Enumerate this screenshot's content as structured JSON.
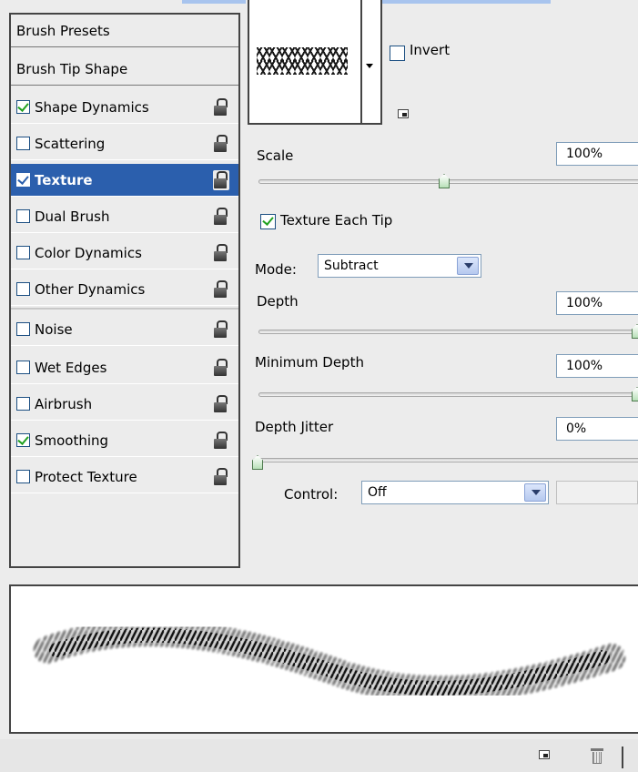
{
  "brush_settings": {
    "list": [
      {
        "label": "Brush Presets",
        "type": "header"
      },
      {
        "label": "Brush Tip Shape",
        "type": "header"
      },
      {
        "label": "Shape Dynamics",
        "checked": true
      },
      {
        "label": "Scattering",
        "checked": false
      },
      {
        "label": "Texture",
        "checked": true,
        "selected": true
      },
      {
        "label": "Dual Brush",
        "checked": false
      },
      {
        "label": "Color Dynamics",
        "checked": false
      },
      {
        "label": "Other Dynamics",
        "checked": false
      },
      {
        "label": "Noise",
        "checked": false
      },
      {
        "label": "Wet Edges",
        "checked": false
      },
      {
        "label": "Airbrush",
        "checked": false
      },
      {
        "label": "Smoothing",
        "checked": true
      },
      {
        "label": "Protect Texture",
        "checked": false
      }
    ]
  },
  "texture": {
    "invert_label": "Invert",
    "invert_checked": false,
    "scale_label": "Scale",
    "scale_value": "100%",
    "scale_fraction": 0.5,
    "texture_each_tip_label": "Texture Each Tip",
    "texture_each_tip_checked": true,
    "mode_label": "Mode:",
    "mode_value": "Subtract",
    "depth_label": "Depth",
    "depth_value": "100%",
    "depth_fraction": 1.0,
    "min_depth_label": "Minimum Depth",
    "min_depth_value": "100%",
    "min_depth_fraction": 1.0,
    "depth_jitter_label": "Depth Jitter",
    "depth_jitter_value": "0%",
    "depth_jitter_fraction": 0.0,
    "control_label": "Control:",
    "control_value": "Off"
  },
  "colors": {
    "selected_bg": "#2b5fad",
    "check_green": "#21a121",
    "panel_bg": "#ececec"
  },
  "icons": {
    "lock": "lock-icon",
    "new": "new-brush-icon",
    "trash": "trash-icon"
  }
}
